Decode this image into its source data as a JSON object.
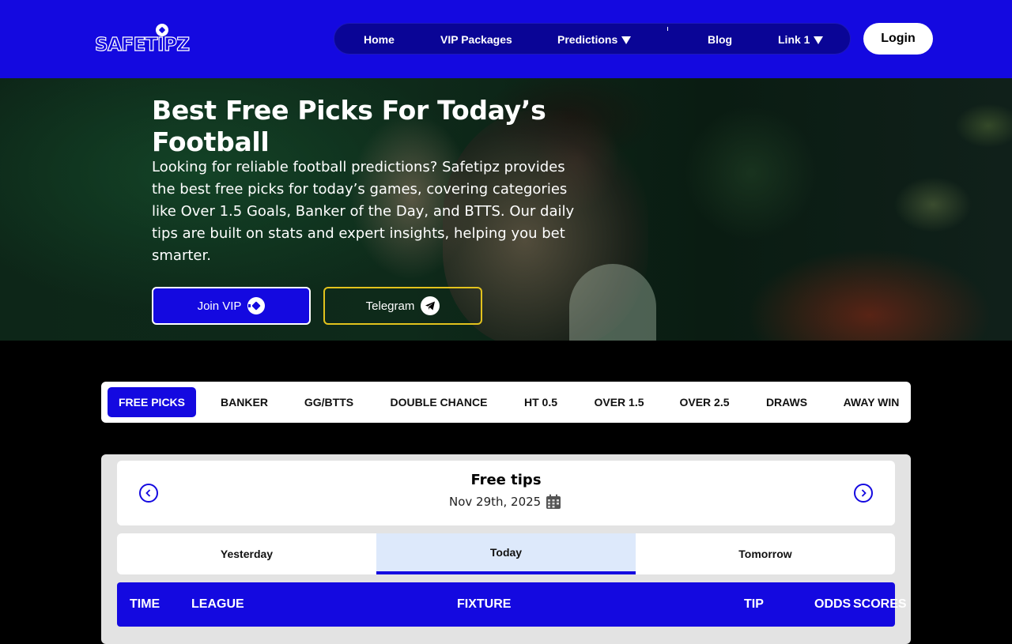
{
  "brand": {
    "logo_text": "SAFETIPZ"
  },
  "nav": {
    "items": [
      {
        "label": "Home"
      },
      {
        "label": "VIP Packages"
      },
      {
        "label": "Predictions"
      },
      {
        "label": "Blog"
      },
      {
        "label": "Link 1"
      }
    ],
    "login_label": "Login"
  },
  "hero": {
    "title": "Best Free Picks For Today’s Football",
    "description": "Looking for reliable football predictions? Safetipz provides the best free picks for today’s games, covering categories like Over 1.5 Goals, Banker of the Day, and BTTS. Our daily tips are built on stats and expert insights, helping you bet smarter.",
    "join_vip_label": "Join VIP",
    "telegram_label": "Telegram"
  },
  "category_tabs": [
    {
      "label": "FREE PICKS",
      "active": true
    },
    {
      "label": "BANKER"
    },
    {
      "label": "GG/BTTS"
    },
    {
      "label": "DOUBLE CHANCE"
    },
    {
      "label": "HT 0.5"
    },
    {
      "label": "OVER 1.5"
    },
    {
      "label": "OVER 2.5"
    },
    {
      "label": "DRAWS"
    },
    {
      "label": "AWAY WIN"
    }
  ],
  "tips_panel": {
    "title": "Free tips",
    "date": "Nov 29th, 2025",
    "day_tabs": [
      {
        "label": "Yesterday"
      },
      {
        "label": "Today",
        "active": true
      },
      {
        "label": "Tomorrow"
      }
    ],
    "columns": [
      "TIME",
      "LEAGUE",
      "FIXTURE",
      "TIP",
      "ODDS",
      "SCORES"
    ]
  },
  "colors": {
    "brand_blue": "#1409e0",
    "nav_dark": "#0a0596",
    "telegram_border": "#e2c21d",
    "active_day_bg": "#dde9fb"
  },
  "icons": [
    "soccer-ball-icon",
    "telegram-icon",
    "calendar-icon",
    "chevron-left-icon",
    "chevron-right-icon",
    "caret-down-icon"
  ]
}
